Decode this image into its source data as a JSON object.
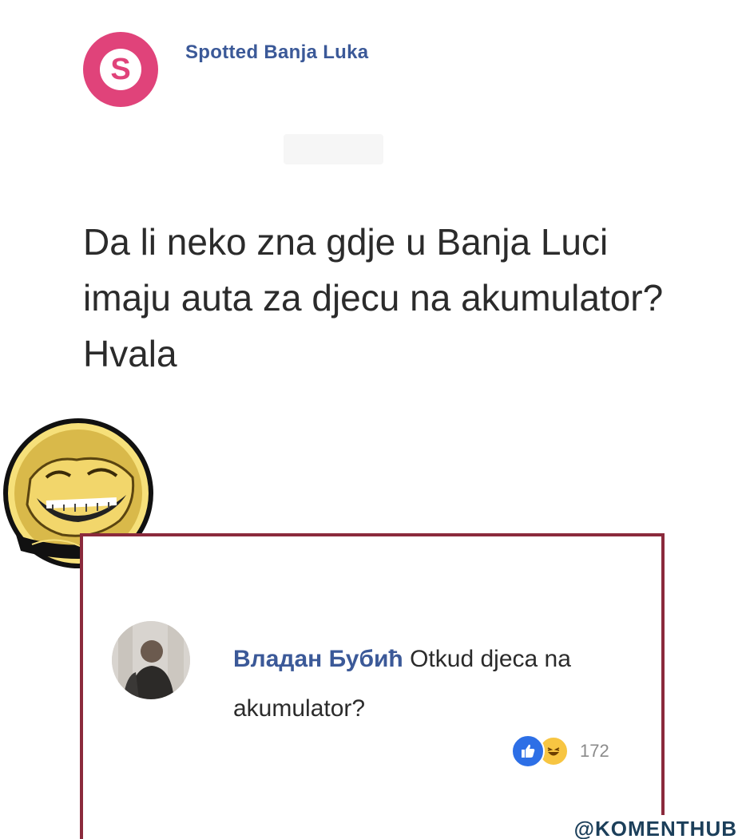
{
  "post": {
    "page_avatar_letter": "S",
    "page_name": "Spotted Banja Luka",
    "text": "Da li neko zna gdje u Banja Luci imaju auta  za djecu na akumulator? Hvala"
  },
  "comment": {
    "author": "Владан Бубић",
    "text": "Otkud djeca na akumulator?",
    "reaction_count": "172",
    "reactions": [
      "like-icon",
      "haha-icon"
    ]
  },
  "watermark": "@KOMENTHUB",
  "colors": {
    "page_avatar": "#e0437a",
    "author_link": "#3b5998",
    "highlight_border": "#8b2a3c",
    "like": "#2d6fe6",
    "haha": "#f7c542"
  }
}
